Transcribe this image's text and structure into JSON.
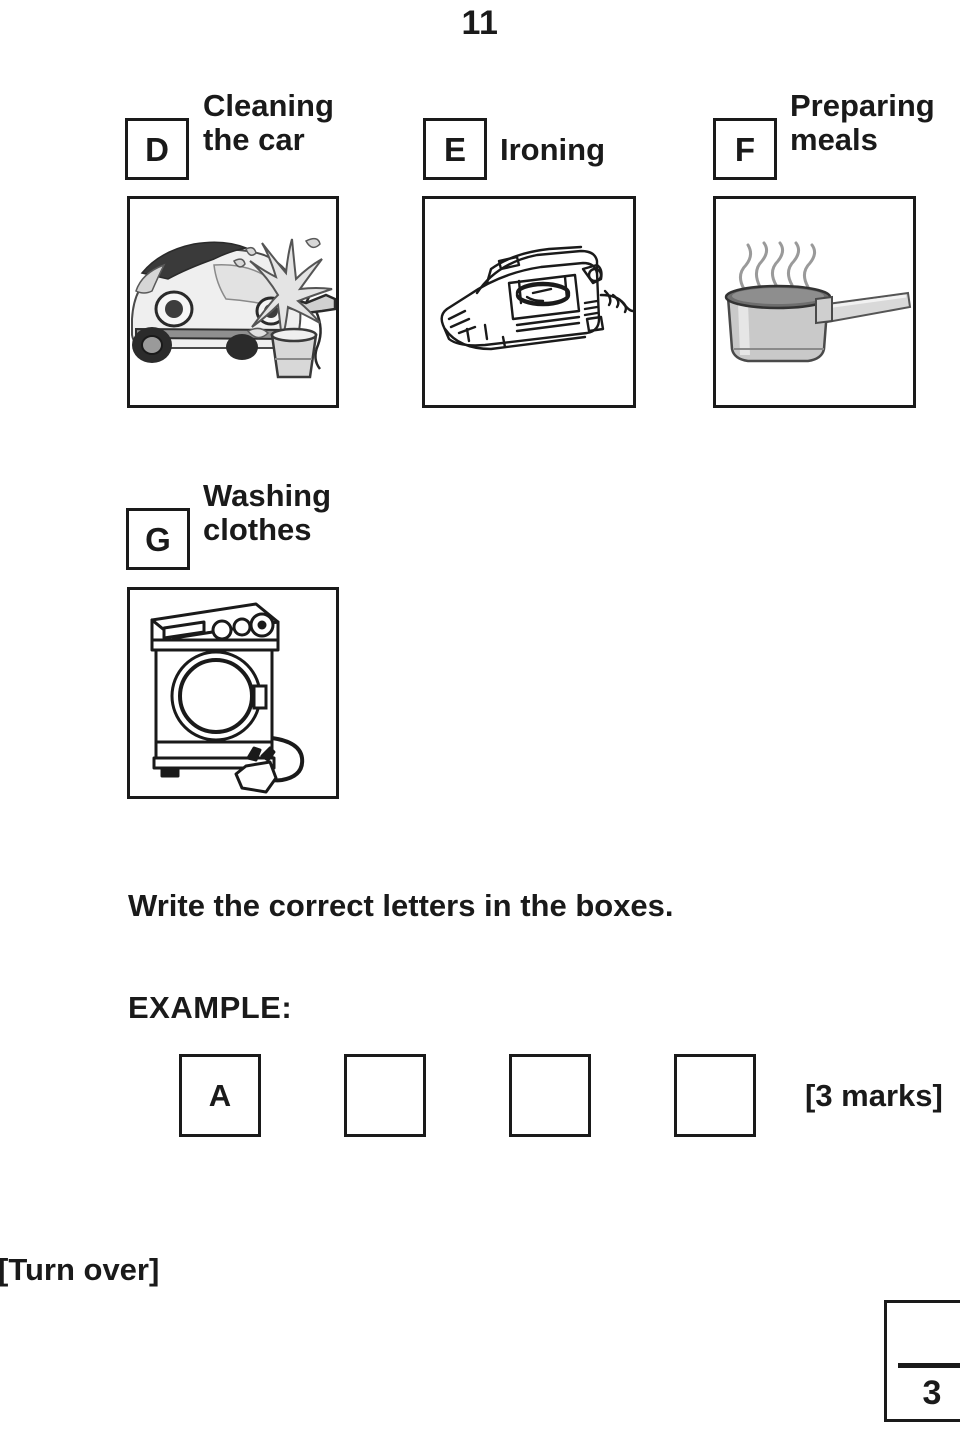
{
  "page": {
    "number": "11",
    "footer_note": "[Turn over]",
    "mark_box_value": "3"
  },
  "options": [
    {
      "letter": "D",
      "label": "Cleaning\nthe car",
      "image": "car-washing-illustration"
    },
    {
      "letter": "E",
      "label": "Ironing",
      "image": "clothes-iron-illustration"
    },
    {
      "letter": "F",
      "label": "Preparing\nmeals",
      "image": "saucepan-illustration"
    },
    {
      "letter": "G",
      "label": "Washing\nclothes",
      "image": "washing-machine-illustration"
    }
  ],
  "instruction": {
    "text": "Write the correct letters in the boxes.",
    "example_label": "EXAMPLE:",
    "marks": "[3 marks]"
  },
  "answer_boxes": [
    {
      "value": "A"
    },
    {
      "value": ""
    },
    {
      "value": ""
    },
    {
      "value": ""
    }
  ],
  "colors": {
    "ink": "#1a1a1a",
    "paper": "#ffffff",
    "illustration_light": "#e8e8e8",
    "illustration_mid": "#bdbdbd",
    "illustration_dark": "#6e6e6e"
  }
}
